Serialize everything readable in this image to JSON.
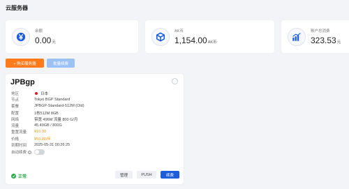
{
  "page": {
    "title": "云服务器"
  },
  "stats": [
    {
      "label": "余额",
      "value": "0.00",
      "unit": "元",
      "icon": "yen-icon"
    },
    {
      "label": "AK币",
      "value": "1,154.00",
      "unit": "AK币",
      "icon": "cube-icon"
    },
    {
      "label": "账户总消费",
      "value": "323.53",
      "unit": "元",
      "icon": "bar-chart-icon"
    }
  ],
  "toolbar": {
    "buy_label": "+ 购买服务器",
    "batch_renew_label": "批量续费"
  },
  "server": {
    "name": "JPBgp",
    "rows": [
      {
        "label": "地区",
        "value": "日本",
        "flag": true
      },
      {
        "label": "节点",
        "value": "Tokyo BGP Standard"
      },
      {
        "label": "套餐",
        "value": "JPBGP-Standard-512M (Old)"
      },
      {
        "label": "配置",
        "value": "1核512M 8GB"
      },
      {
        "label": "网络",
        "value": "带宽 496M 流量 800 G/月"
      },
      {
        "label": "流量",
        "value": "45.49GB / 800G"
      },
      {
        "label": "重置流量",
        "value": "¥10.00",
        "highlight": true
      },
      {
        "label": "价格",
        "value": "¥93.88/年",
        "highlight": true
      },
      {
        "label": "到期时间",
        "value": "2025-05-31 00:26:25"
      }
    ],
    "auto_renew_label": "自动续费",
    "auto_renew_enabled": false,
    "status": "正常",
    "buttons": {
      "manage": "管理",
      "push": "PUSH",
      "renew": "续费"
    }
  },
  "colors": {
    "accent_orange": "#ff7a1a",
    "accent_blue": "#1b5ddb",
    "status_green": "#2fa84f",
    "price_orange": "#f39a16"
  }
}
